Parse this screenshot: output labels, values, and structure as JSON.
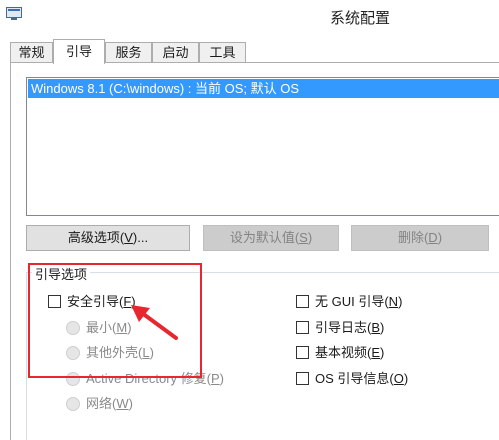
{
  "window": {
    "title": "系统配置"
  },
  "tabs": [
    {
      "label": "常规",
      "active": false
    },
    {
      "label": "引导",
      "active": true
    },
    {
      "label": "服务",
      "active": false
    },
    {
      "label": "启动",
      "active": false
    },
    {
      "label": "工具",
      "active": false
    }
  ],
  "os_list": {
    "entries": [
      "Windows 8.1 (C:\\windows) : 当前 OS; 默认 OS"
    ],
    "selected_index": 0
  },
  "buttons": {
    "advanced": {
      "label": "高级选项(",
      "accel": "V",
      "suffix": ")...",
      "enabled": true
    },
    "set_default": {
      "label": "设为默认值(",
      "accel": "S",
      "suffix": ")",
      "enabled": false
    },
    "delete": {
      "label": "删除(",
      "accel": "D",
      "suffix": ")",
      "enabled": false
    }
  },
  "boot_options": {
    "title": "引导选项",
    "safe_boot": {
      "label": "安全引导(",
      "accel": "F",
      "suffix": ")",
      "checked": false
    },
    "radios": [
      {
        "label": "最小(",
        "accel": "M",
        "suffix": ")",
        "enabled": false
      },
      {
        "label": "其他外壳(",
        "accel": "L",
        "suffix": ")",
        "enabled": false
      },
      {
        "label": "Active Directory 修复(",
        "accel": "P",
        "suffix": ")",
        "enabled": false
      },
      {
        "label": "网络(",
        "accel": "W",
        "suffix": ")",
        "enabled": false
      }
    ],
    "right_checks": [
      {
        "label": "无 GUI 引导(",
        "accel": "N",
        "suffix": ")",
        "checked": false
      },
      {
        "label": "引导日志(",
        "accel": "B",
        "suffix": ")",
        "checked": false
      },
      {
        "label": "基本视频(",
        "accel": "E",
        "suffix": ")",
        "checked": false
      },
      {
        "label": "OS 引导信息(",
        "accel": "O",
        "suffix": ")",
        "checked": false
      }
    ]
  },
  "colors": {
    "selection": "#3399ff",
    "annotation": "#e8262e",
    "disabled_text": "#8a8a8a"
  }
}
